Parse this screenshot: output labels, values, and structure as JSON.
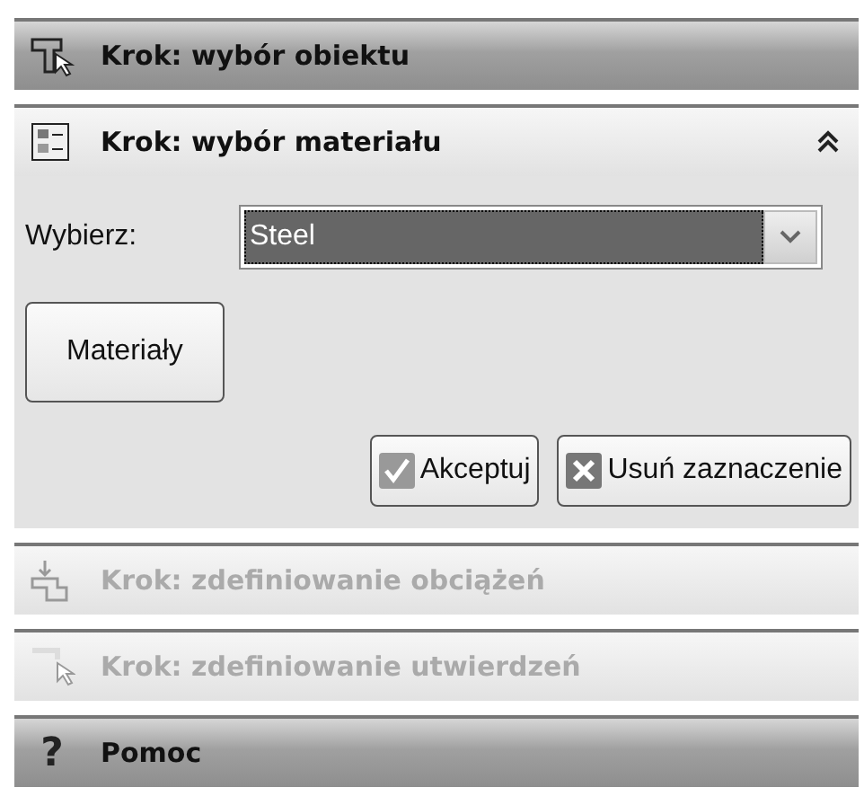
{
  "panels": [
    {
      "kind": "select",
      "title": "Krok: wybór obiektu",
      "highlighted": true,
      "disabled": false,
      "expanded": false
    },
    {
      "kind": "material",
      "title": "Krok: wybór materiału",
      "highlighted": false,
      "disabled": false,
      "expanded": true,
      "body": {
        "select_label": "Wybierz:",
        "select_value": "Steel",
        "materials_button": "Materiały",
        "accept_button": "Akceptuj",
        "clear_button": "Usuń zaznaczenie"
      }
    },
    {
      "kind": "load",
      "title": "Krok: zdefiniowanie obciążeń",
      "highlighted": false,
      "disabled": true,
      "expanded": false
    },
    {
      "kind": "support",
      "title": "Krok: zdefiniowanie utwierdzeń",
      "highlighted": false,
      "disabled": true,
      "expanded": false
    },
    {
      "kind": "help",
      "icon_text": "?",
      "title": "Pomoc",
      "highlighted": true,
      "disabled": false,
      "expanded": false
    }
  ]
}
